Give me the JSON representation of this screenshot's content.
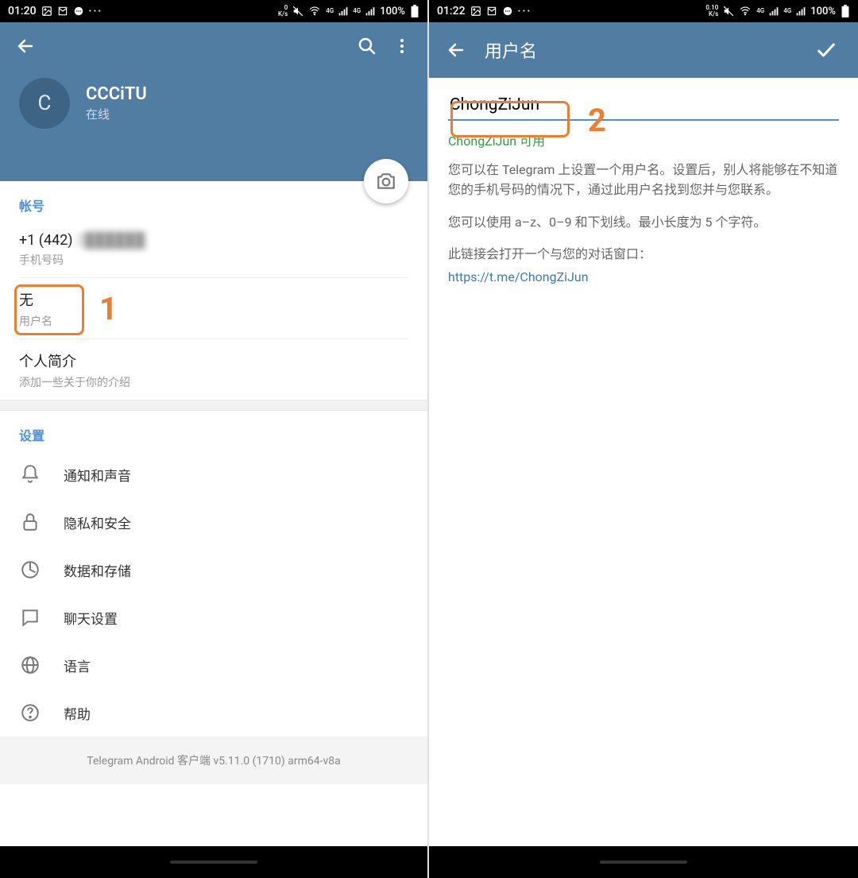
{
  "left": {
    "statusbar": {
      "time": "01:20",
      "speed_top": "0",
      "speed_bottom": "K/s",
      "net_label": "4G",
      "battery_pct": "100%"
    },
    "profile": {
      "avatar_letter": "C",
      "name": "CCCiTU",
      "status": "在线"
    },
    "account": {
      "header": "帐号",
      "phone_prefix": "+1 (442) ",
      "phone_hidden": "2██████",
      "phone_label": "手机号码",
      "username_value": "无",
      "username_label": "用户名",
      "bio_value": "个人简介",
      "bio_label": "添加一些关于你的介绍"
    },
    "settings": {
      "header": "设置",
      "notifications": "通知和声音",
      "privacy": "隐私和安全",
      "data": "数据和存储",
      "chat": "聊天设置",
      "language": "语言",
      "help": "帮助"
    },
    "version": "Telegram Android 客户端 v5.11.0 (1710) arm64-v8a",
    "callouts": {
      "one": "1"
    }
  },
  "right": {
    "statusbar": {
      "time": "01:22",
      "speed_top": "0.10",
      "speed_bottom": "K/s",
      "net_label": "4G",
      "battery_pct": "100%"
    },
    "header_title": "用户名",
    "input_value": "ChongZiJun",
    "availability": "ChongZiJun 可用",
    "help_p1": "您可以在 Telegram 上设置一个用户名。设置后，别人将能够在不知道您的手机号码的情况下，通过此用户名找到您并与您联系。",
    "help_p2": "您可以使用 a–z、0–9 和下划线。最小长度为 5 个字符。",
    "help_p3": "此链接会打开一个与您的对话窗口：",
    "link": "https://t.me/ChongZiJun",
    "callouts": {
      "two": "2"
    }
  }
}
